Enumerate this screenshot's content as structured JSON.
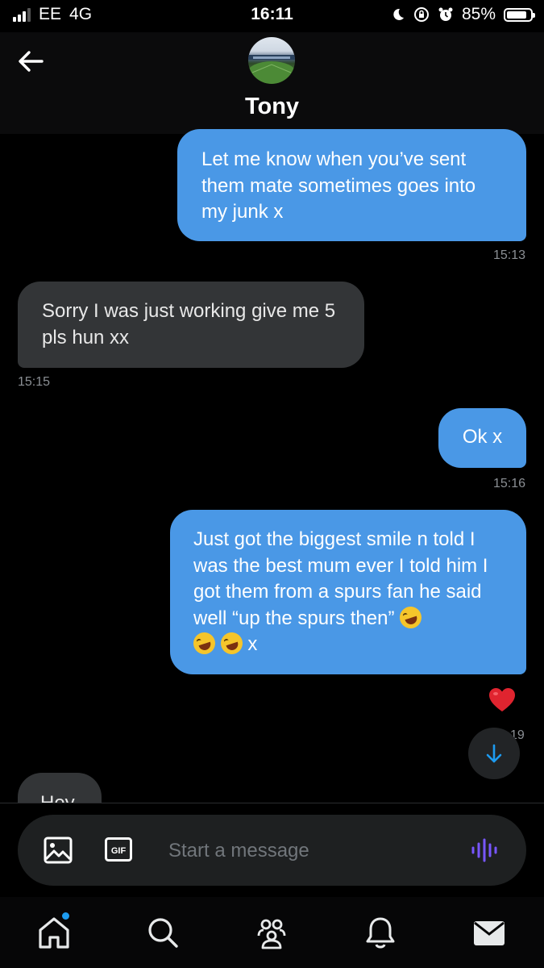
{
  "status_bar": {
    "carrier": "EE",
    "network": "4G",
    "time": "16:11",
    "battery_percent": "85%",
    "battery_level": 0.85,
    "icons": [
      "signal-icon",
      "moon-icon",
      "orientation-lock-icon",
      "alarm-icon",
      "battery-icon"
    ]
  },
  "header": {
    "contact_name": "Tony",
    "back_icon": "arrow-left-icon",
    "avatar": "stadium-avatar"
  },
  "messages": [
    {
      "direction": "out",
      "text": "Let me know when you’ve sent them mate sometimes goes into my junk x",
      "time": "15:13"
    },
    {
      "direction": "in",
      "text": "Sorry I was just working give me 5 pls hun xx",
      "time": "15:15"
    },
    {
      "direction": "out",
      "text": "Ok x",
      "time": "15:16"
    },
    {
      "direction": "out",
      "text": "Just got the biggest smile n told I was the best mum ever I told him I got them from a spurs fan he said well “up the spurs then”",
      "emoji_suffix": "🤣",
      "line2_emojis": "🤣🤣",
      "line2_text": "x",
      "time": "19",
      "reaction": "heart"
    }
  ],
  "partial_message": {
    "direction": "in",
    "text": "Hey"
  },
  "composer": {
    "placeholder": "Start a message",
    "image_icon": "image-icon",
    "gif_label": "GIF",
    "voice_icon": "voice-waveform-icon"
  },
  "tabbar": {
    "items": [
      "home-icon",
      "search-icon",
      "communities-icon",
      "notifications-icon",
      "messages-icon"
    ],
    "active": "messages-icon"
  },
  "colors": {
    "outgoing_bubble": "#4a98e6",
    "incoming_bubble": "#333537",
    "accent_blue": "#1d9bf0",
    "voice_purple": "#7856ff"
  }
}
